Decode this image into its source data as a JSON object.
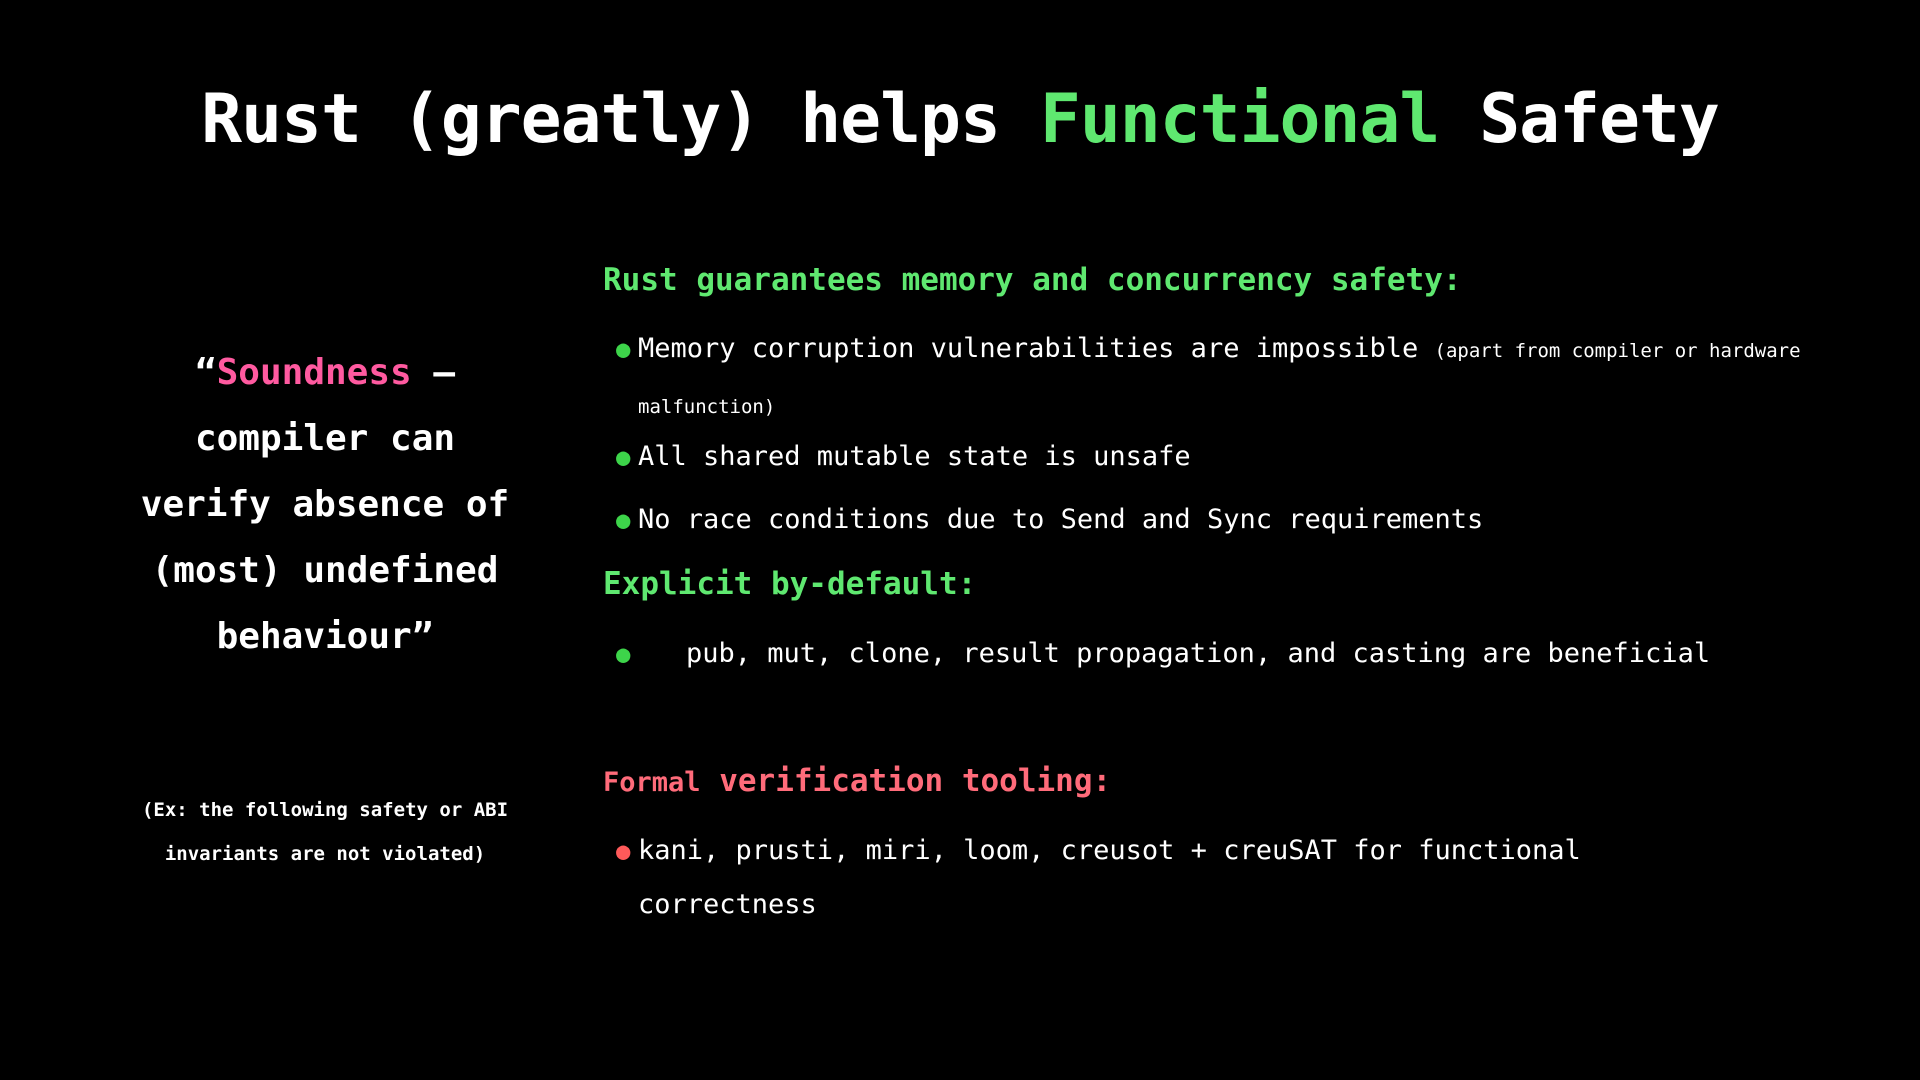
{
  "title": {
    "part1": "Rust (greatly) helps ",
    "highlight": "Functional",
    "part2": " Safety"
  },
  "quote": {
    "open": "“",
    "highlight": "Soundness",
    "rest": " – compiler can verify absence of (most) undefined behaviour”",
    "example": "(Ex: the following safety or ABI invariants are not violated)"
  },
  "sections": {
    "guarantees": {
      "heading": "Rust guarantees memory and concurrency safety:",
      "items": [
        {
          "text": "Memory corruption vulnerabilities are impossible ",
          "note": "(apart from compiler or hardware malfunction)"
        },
        {
          "text": "All shared mutable state is unsafe"
        },
        {
          "text": "No race conditions due to Send and Sync requirements"
        }
      ]
    },
    "explicit": {
      "heading": "Explicit by-default:",
      "items": [
        {
          "text": "pub, mut, clone, result propagation, and casting are beneficial"
        }
      ]
    },
    "formal": {
      "heading_first": "Formal",
      "heading_rest": " verification tooling:",
      "items": [
        {
          "text": "kani, prusti, miri, loom, creusot + creuSAT for functional correctness"
        }
      ]
    }
  },
  "colors": {
    "background": "#000000",
    "green": "#5fe870",
    "pink": "#ff5aa0",
    "red": "#ff6b7a"
  }
}
